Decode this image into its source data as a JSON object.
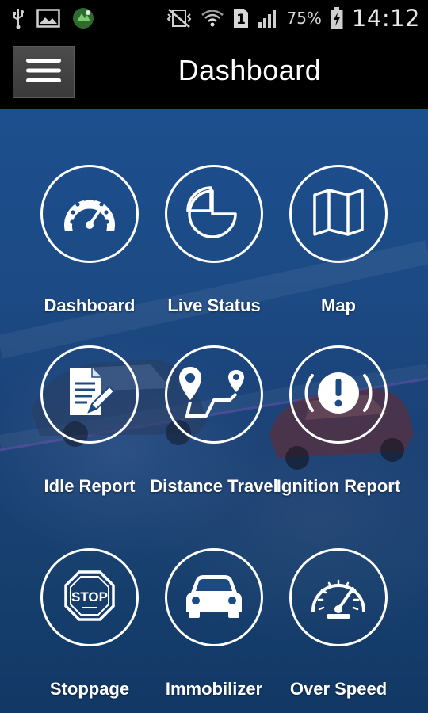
{
  "status_bar": {
    "icons_left": [
      "usb-icon",
      "image-icon",
      "app-notification-icon"
    ],
    "icons_right": [
      "vibrate-off-icon",
      "wifi-icon",
      "sim-icon",
      "signal-icon",
      "battery-icon"
    ],
    "sim_label": "1",
    "battery_percent": "75%",
    "time": "14:12"
  },
  "app_bar": {
    "title": "Dashboard"
  },
  "tiles": [
    {
      "label": "Dashboard",
      "icon": "speedometer-icon"
    },
    {
      "label": "Live Status",
      "icon": "pie-chart-icon"
    },
    {
      "label": "Map",
      "icon": "map-icon"
    },
    {
      "label": "Idle Report",
      "icon": "document-edit-icon"
    },
    {
      "label": "Distance Travel",
      "icon": "route-icon"
    },
    {
      "label": "Ignition Report",
      "icon": "alert-circle-icon"
    },
    {
      "label": "Stoppage",
      "icon": "stop-sign-icon"
    },
    {
      "label": "Immobilizer",
      "icon": "car-icon"
    },
    {
      "label": "Over Speed",
      "icon": "gauge-icon"
    }
  ],
  "colors": {
    "background_top": "#1d4f8e",
    "background_bottom": "#123865",
    "status_bar": "#000000",
    "icon_stroke": "#ffffff"
  }
}
